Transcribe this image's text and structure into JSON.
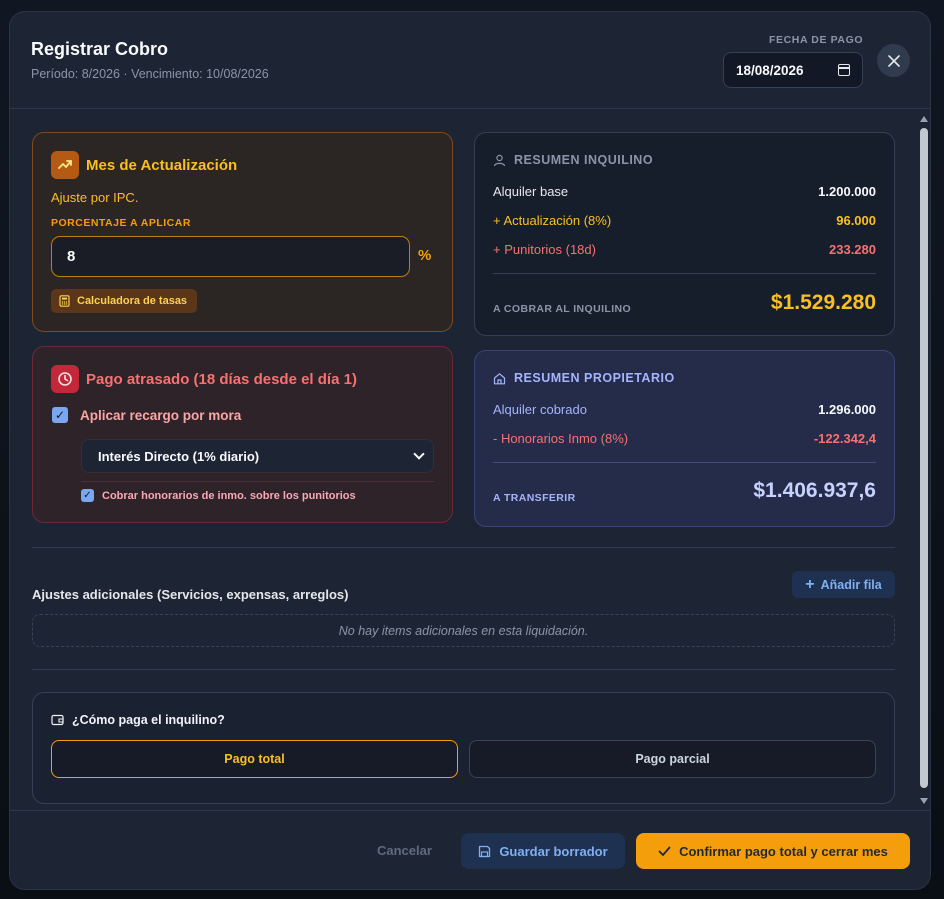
{
  "header": {
    "title": "Registrar Cobro",
    "subtitle": "Período: 8/2026 · Vencimiento: 10/08/2026",
    "date_label": "FECHA DE PAGO",
    "date_value": "18/08/2026"
  },
  "actualizacion": {
    "title": "Mes de Actualización",
    "description": "Ajuste por IPC.",
    "percent_label": "PORCENTAJE A APLICAR",
    "percent_value": "8",
    "percent_sign": "%",
    "calc_button": "Calculadora de tasas"
  },
  "atrasado": {
    "title": "Pago atrasado (18 días desde el día 1)",
    "apply_label": "Aplicar recargo por mora",
    "apply_checked": true,
    "interest_selected": "Interés Directo (1% diario)",
    "fees_label": "Cobrar honorarios de inmo. sobre los punitorios",
    "fees_checked": true
  },
  "resumen_inquilino": {
    "title": "RESUMEN INQUILINO",
    "rows": [
      {
        "label": "Alquiler base",
        "value": "1.200.000"
      },
      {
        "label": "+ Actualización (8%)",
        "value": "96.000"
      },
      {
        "label": "+ Punitorios (18d)",
        "value": "233.280"
      }
    ],
    "total_label": "A COBRAR AL INQUILINO",
    "total_value": "$1.529.280"
  },
  "resumen_propietario": {
    "title": "RESUMEN PROPIETARIO",
    "rows": [
      {
        "label": "Alquiler cobrado",
        "value": "1.296.000"
      },
      {
        "label": "- Honorarios Inmo (8%)",
        "value": "-122.342,4"
      }
    ],
    "total_label": "A TRANSFERIR",
    "total_value": "$1.406.937,6"
  },
  "ajustes": {
    "title": "Ajustes adicionales (Servicios, expensas, arreglos)",
    "add_button": "Añadir fila",
    "empty_text": "No hay items adicionales en esta liquidación."
  },
  "pago": {
    "title": "¿Cómo paga el inquilino?",
    "options": [
      "Pago total",
      "Pago parcial"
    ],
    "selected": "Pago total"
  },
  "footer": {
    "cancel": "Cancelar",
    "draft": "Guardar borrador",
    "confirm": "Confirmar pago total y cerrar mes"
  },
  "colors": {
    "accent": "#f59e0b",
    "danger": "#f87171",
    "info": "#7fb0f5",
    "owner": "#a5b4fc"
  }
}
